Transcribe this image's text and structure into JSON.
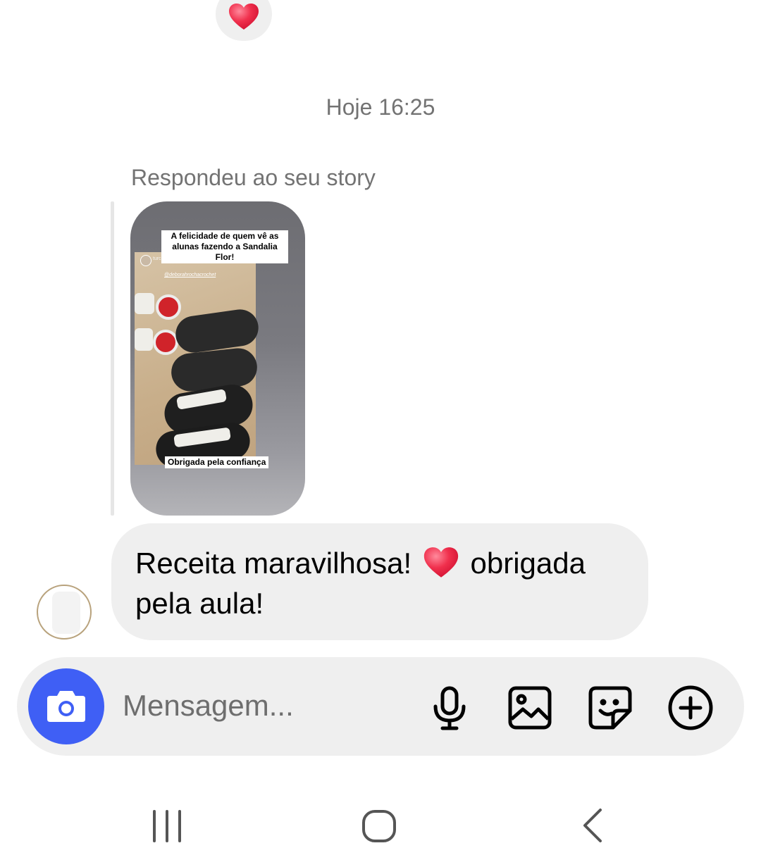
{
  "colors": {
    "accent_blue": "#3f5ff5",
    "bubble_gray": "#efefef",
    "heart_red": "#f0304d",
    "meta_text": "#737373"
  },
  "reaction": {
    "icon": "heart-icon"
  },
  "timestamp": "Hoje 16:25",
  "reply_label": "Respondeu ao seu story",
  "story": {
    "caption_top": "A felicidade de quem vê as alunas fazendo a Sandalia Flor!",
    "username": "turcacroche",
    "tag": "@deborahrochacrochet",
    "caption_bottom": "Obrigada pela confiança"
  },
  "message": {
    "text_before": "Receita maravilhosa!",
    "emoji": "heart-icon",
    "text_after": "obrigada pela aula!"
  },
  "composer": {
    "placeholder": "Mensagem...",
    "icons": [
      "camera-icon",
      "microphone-icon",
      "gallery-icon",
      "sticker-icon",
      "plus-icon"
    ]
  },
  "navigation": {
    "icons": [
      "recent-apps-icon",
      "home-icon",
      "back-icon"
    ]
  }
}
